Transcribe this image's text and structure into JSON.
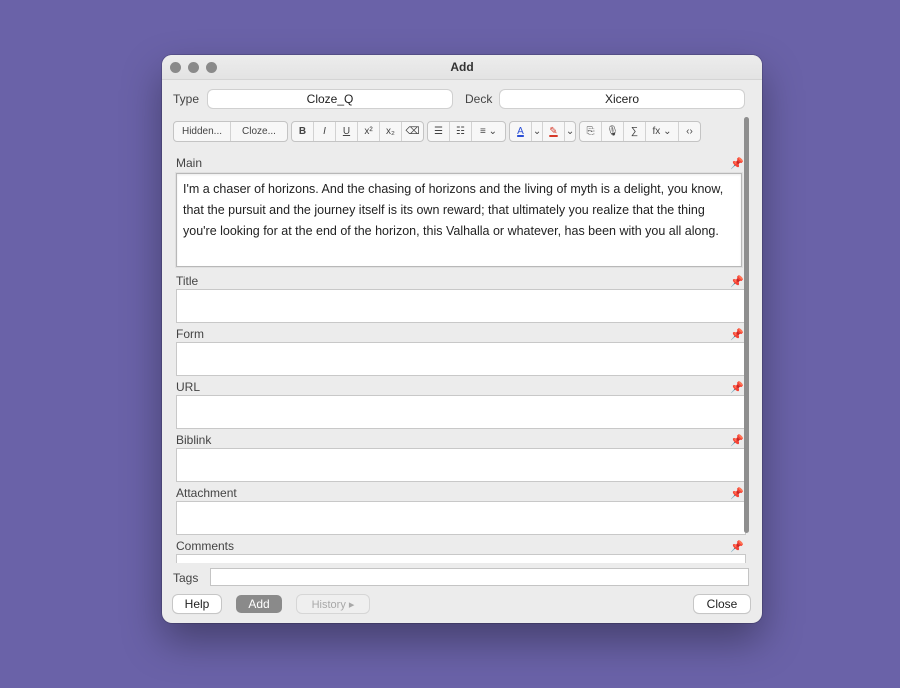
{
  "window": {
    "title": "Add"
  },
  "header": {
    "type_label": "Type",
    "type_value": "Cloze_Q",
    "deck_label": "Deck",
    "deck_value": "Xicero"
  },
  "toolbar": {
    "group1": [
      "Hidden...",
      "Cloze..."
    ],
    "format_buttons": [
      {
        "icon": "bold-icon",
        "glyph": "B"
      },
      {
        "icon": "italic-icon",
        "glyph": "I"
      },
      {
        "icon": "underline-icon",
        "glyph": "U"
      },
      {
        "icon": "superscript-icon",
        "glyph": "x²"
      },
      {
        "icon": "subscript-icon",
        "glyph": "x₂"
      },
      {
        "icon": "eraser-icon",
        "glyph": "⌫"
      }
    ],
    "list_buttons": [
      {
        "icon": "bulleted-list-icon",
        "glyph": "☰"
      },
      {
        "icon": "numbered-list-icon",
        "glyph": "☷"
      },
      {
        "icon": "align-dropdown-icon",
        "glyph": "≡ ⌄"
      }
    ],
    "color_buttons": [
      {
        "icon": "text-color-icon",
        "glyph": "A"
      },
      {
        "icon": "text-color-dropdown-icon",
        "glyph": "⌄"
      },
      {
        "icon": "highlight-icon",
        "glyph": "✎"
      },
      {
        "icon": "highlight-dropdown-icon",
        "glyph": "⌄"
      }
    ],
    "media_buttons": [
      {
        "icon": "attach-icon",
        "glyph": "⎘"
      },
      {
        "icon": "record-audio-icon",
        "glyph": "🎙"
      },
      {
        "icon": "mathjax-icon",
        "glyph": "∑"
      },
      {
        "icon": "formula-dropdown-icon",
        "glyph": "fx ⌄"
      },
      {
        "icon": "html-editor-icon",
        "glyph": "‹›"
      }
    ]
  },
  "fields": {
    "main_label": "Main",
    "main_text": "I'm a chaser of horizons. And the chasing of horizons and the living of myth is a delight, you know, that the pursuit and the journey itself is its own reward; that ultimately you realize that the thing you're looking for at the end of the horizon, this Valhalla or whatever, has been with you all along.",
    "title_label": "Title",
    "form_label": "Form",
    "url_label": "URL",
    "bib_label": "Biblink",
    "attachment_label": "Attachment",
    "comments_label": "Comments"
  },
  "footer": {
    "tags_label": "Tags",
    "tags_value": "",
    "help_label": "Help",
    "add_label": "Add",
    "history_label": "History ▸",
    "close_label": "Close"
  },
  "colors": {
    "background": "#6a62a8",
    "text_color_underline": "#2a4fd6",
    "highlight_underline": "#d63a2a",
    "add_button": "#8a8a8a"
  }
}
